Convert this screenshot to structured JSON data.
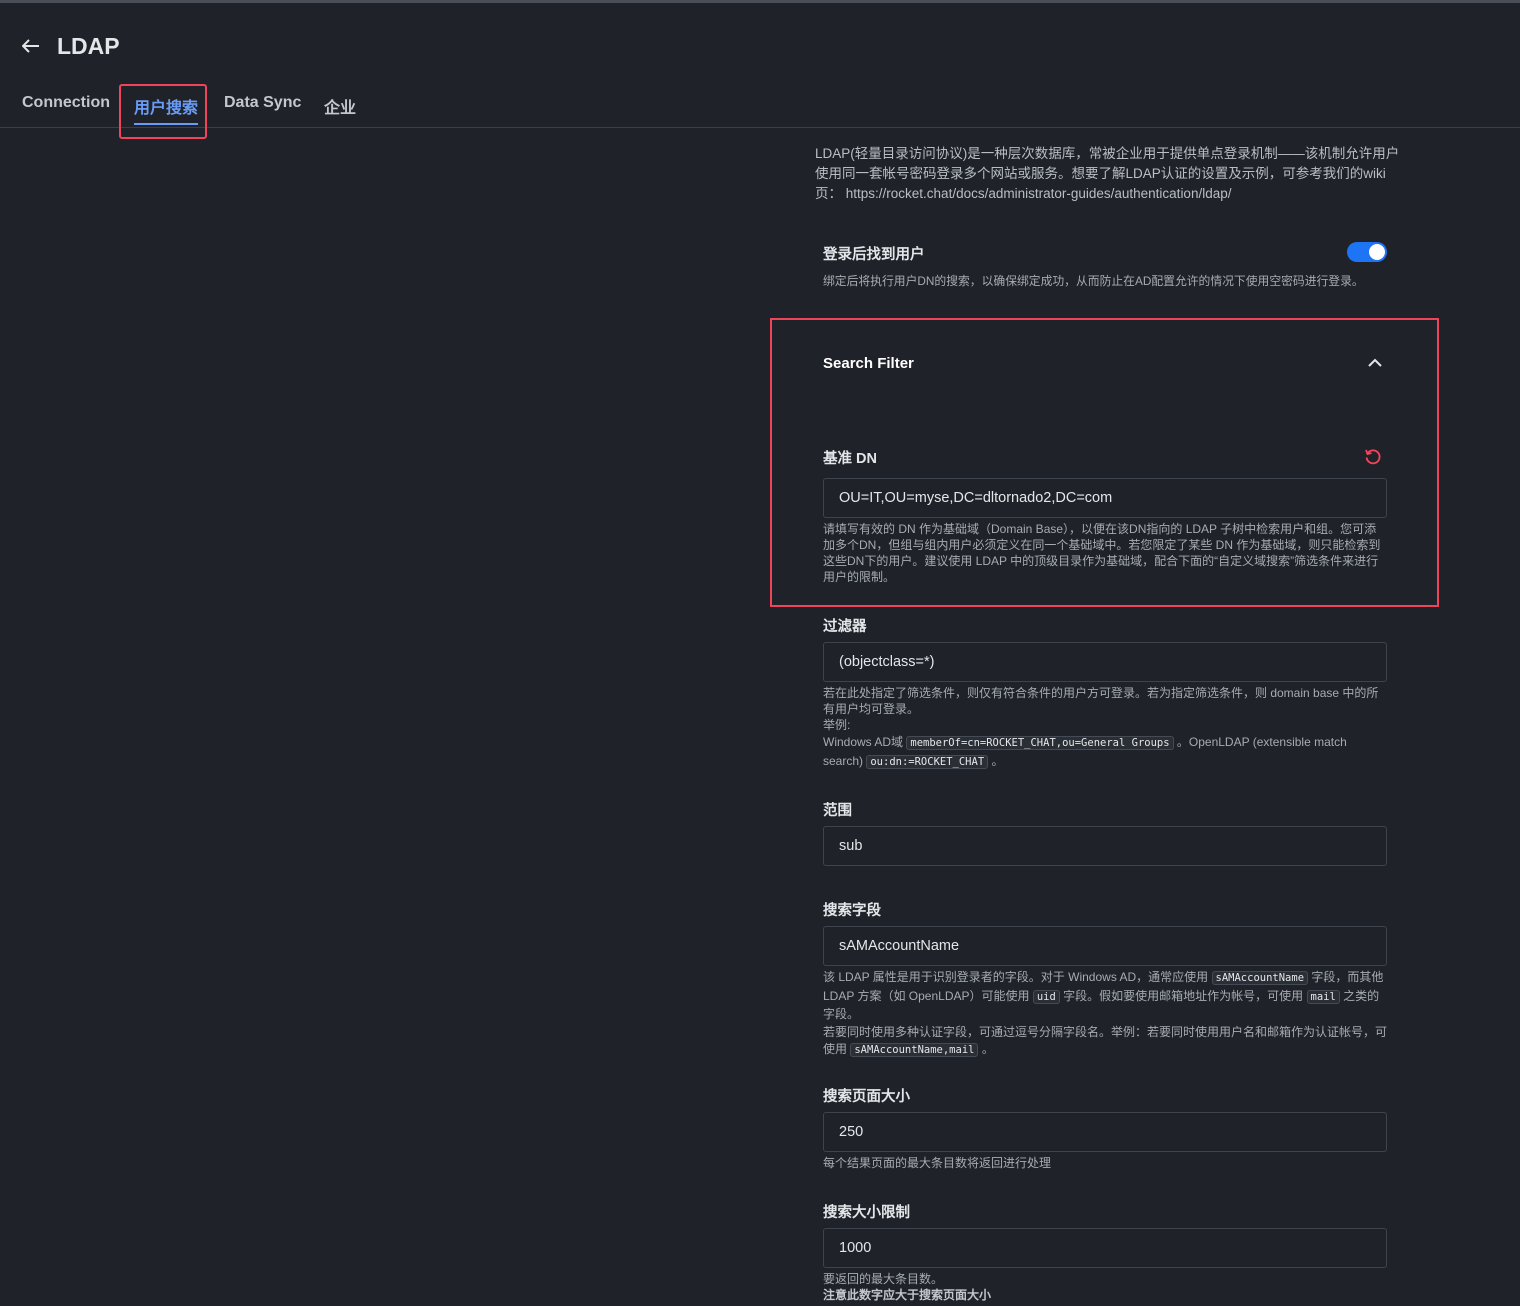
{
  "header": {
    "title": "LDAP",
    "tabs": [
      {
        "label": "Connection",
        "active": false
      },
      {
        "label": "用户搜索",
        "active": true
      },
      {
        "label": "Data Sync",
        "active": false
      },
      {
        "label": "企业",
        "active": false
      }
    ]
  },
  "intro": {
    "text": "LDAP(轻量目录访问协议)是一种层次数据库，常被企业用于提供单点登录机制——该机制允许用户使用同一套帐号密码登录多个网站或服务。想要了解LDAP认证的设置及示例，可参考我们的wiki页：",
    "link": "https://rocket.chat/docs/administrator-guides/authentication/ldap/"
  },
  "find_user_after_login": {
    "label": "登录后找到用户",
    "enabled": true,
    "hint": "绑定后将执行用户DN的搜索，以确保绑定成功，从而防止在AD配置允许的情况下使用空密码进行登录。"
  },
  "search_filter_section": {
    "title": "Search Filter",
    "expanded": true
  },
  "base_dn": {
    "label": "基准 DN",
    "value": "OU=IT,OU=myse,DC=dltornado2,DC=com",
    "hint": "请填写有效的 DN 作为基础域（Domain Base），以便在该DN指向的 LDAP 子树中检索用户和组。您可添加多个DN，但组与组内用户必须定义在同一个基础域中。若您限定了某些 DN 作为基础域，则只能检索到这些DN下的用户。建议使用 LDAP 中的顶级目录作为基础域，配合下面的“自定义域搜索”筛选条件来进行用户的限制。"
  },
  "filter": {
    "label": "过滤器",
    "value": "(objectclass=*)",
    "hint_1": "若在此处指定了筛选条件，则仅有符合条件的用户方可登录。若为指定筛选条件，则 domain base 中的所有用户均可登录。",
    "hint_2": "举例:",
    "hint_3a": "Windows AD域",
    "code_1": "memberOf=cn=ROCKET_CHAT,ou=General Groups",
    "hint_3b": "。OpenLDAP (extensible match search)",
    "code_2": "ou:dn:=ROCKET_CHAT",
    "hint_3c": "。"
  },
  "scope": {
    "label": "范围",
    "value": "sub"
  },
  "search_field": {
    "label": "搜索字段",
    "value": "sAMAccountName",
    "hint_a": "该 LDAP 属性是用于识别登录者的字段。对于 Windows AD，通常应使用",
    "code_1": "sAMAccountName",
    "hint_b": "字段，而其他 LDAP 方案（如 OpenLDAP）可能使用",
    "code_2": "uid",
    "hint_c": "字段。假如要使用邮箱地址作为帐号，可使用",
    "code_3": "mail",
    "hint_d": "之类的字段。",
    "hint_e": "若要同时使用多种认证字段，可通过逗号分隔字段名。举例：若要同时使用用户名和邮箱作为认证帐号，可使用",
    "code_4": "sAMAccountName,mail",
    "hint_f": "。"
  },
  "page_size": {
    "label": "搜索页面大小",
    "value": "250",
    "hint": "每个结果页面的最大条目数将返回进行处理"
  },
  "size_limit": {
    "label": "搜索大小限制",
    "value": "1000",
    "hint_1": "要返回的最大条目数。",
    "hint_2": "注意此数字应大于搜索页面大小"
  },
  "colors": {
    "background": "#1f2329",
    "accent": "#6a9cf7",
    "toggle_on": "#1d74f5",
    "highlight": "#f0445a",
    "reset_icon": "#f5455c"
  },
  "icons": [
    "back-arrow-icon",
    "chevron-up-icon",
    "reset-icon"
  ]
}
